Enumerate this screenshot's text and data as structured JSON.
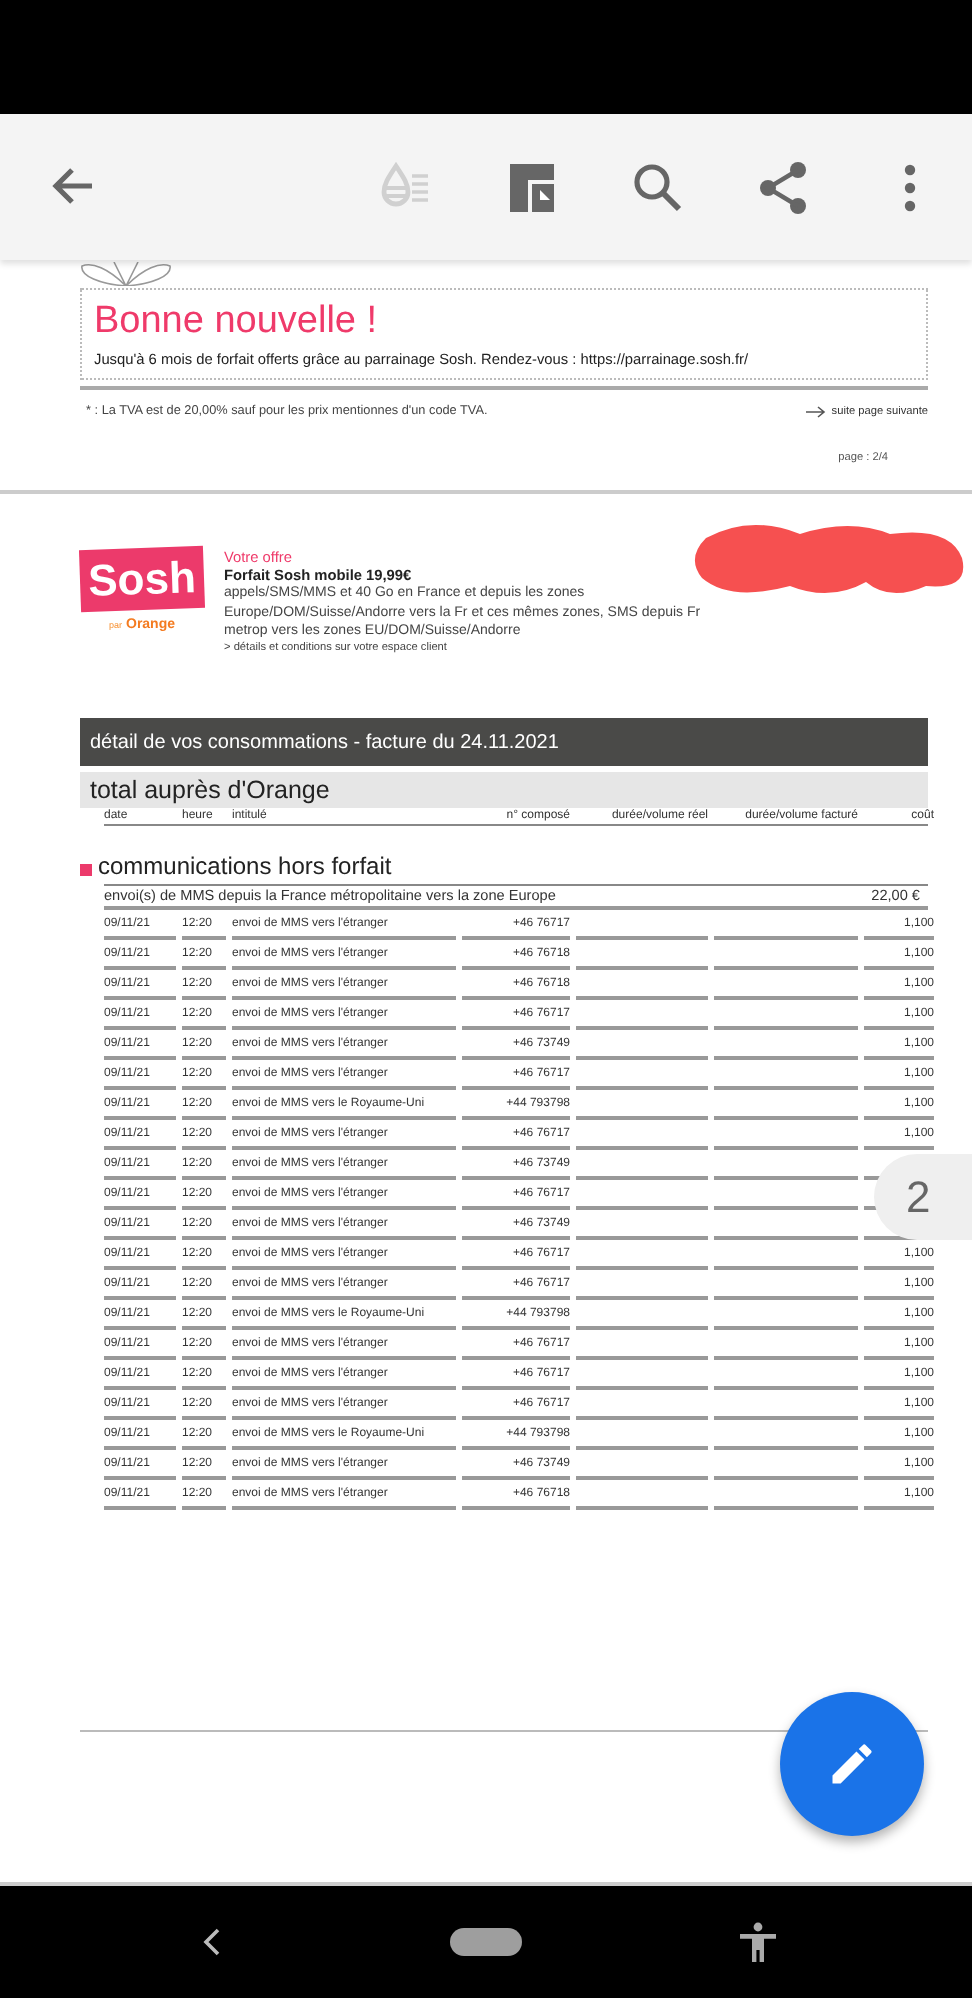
{
  "toolbar": {
    "buttons": [
      {
        "kind": "back",
        "disabled": false
      },
      {
        "kind": "ink",
        "disabled": true
      },
      {
        "kind": "layout",
        "disabled": false
      },
      {
        "kind": "search",
        "disabled": false
      },
      {
        "kind": "share",
        "disabled": false
      },
      {
        "kind": "more",
        "disabled": false
      }
    ]
  },
  "page_2": {
    "promo": {
      "title": "Bonne nouvelle !",
      "text": "Jusqu'à 6 mois de forfait offerts grâce au parrainage Sosh. Rendez-vous : https://parrainage.sosh.fr/"
    },
    "footnote": "* : La TVA est de 20,00% sauf pour les prix mentionnes d'un code TVA.",
    "next_page": "suite page suivante",
    "page_number": "page : 2/4"
  },
  "page_3": {
    "offer": {
      "logo": "Sosh",
      "logo_by": "par",
      "logo_brand": "Orange",
      "label": "Votre offre",
      "plan": "Forfait Sosh mobile 19,99€",
      "description": [
        "appels/SMS/MMS et 40 Go en France et depuis les zones",
        "Europe/DOM/Suisse/Andorre vers la Fr et ces mêmes zones, SMS depuis Fr",
        "metrop vers les zones EU/DOM/Suisse/Andorre"
      ],
      "link": "> détails et conditions sur votre espace client"
    },
    "section_title": "détail de vos consommations - facture du 24.11.2021",
    "total_title": "total auprès d'Orange",
    "columns": [
      "date",
      "heure",
      "intitulé",
      "n° composé",
      "durée/volume réel",
      "durée/volume facturé",
      "coût"
    ],
    "category": "communications hors forfait",
    "group": {
      "label": "envoi(s) de MMS depuis la France métropolitaine vers la zone Europe",
      "amount": "22,00 €"
    },
    "rows": [
      {
        "date": "09/11/21",
        "time": "12:20",
        "label": "envoi de MMS vers l'étranger",
        "number": "+46 76717",
        "cost": "1,100"
      },
      {
        "date": "09/11/21",
        "time": "12:20",
        "label": "envoi de MMS vers l'étranger",
        "number": "+46 76718",
        "cost": "1,100"
      },
      {
        "date": "09/11/21",
        "time": "12:20",
        "label": "envoi de MMS vers l'étranger",
        "number": "+46 76718",
        "cost": "1,100"
      },
      {
        "date": "09/11/21",
        "time": "12:20",
        "label": "envoi de MMS vers l'étranger",
        "number": "+46 76717",
        "cost": "1,100"
      },
      {
        "date": "09/11/21",
        "time": "12:20",
        "label": "envoi de MMS vers l'étranger",
        "number": "+46 73749",
        "cost": "1,100"
      },
      {
        "date": "09/11/21",
        "time": "12:20",
        "label": "envoi de MMS vers l'étranger",
        "number": "+46 76717",
        "cost": "1,100"
      },
      {
        "date": "09/11/21",
        "time": "12:20",
        "label": "envoi de MMS vers le Royaume-Uni",
        "number": "+44 793798",
        "cost": "1,100"
      },
      {
        "date": "09/11/21",
        "time": "12:20",
        "label": "envoi de MMS vers l'étranger",
        "number": "+46 76717",
        "cost": "1,100"
      },
      {
        "date": "09/11/21",
        "time": "12:20",
        "label": "envoi de MMS vers l'étranger",
        "number": "+46 73749"
      },
      {
        "date": "09/11/21",
        "time": "12:20",
        "label": "envoi de MMS vers l'étranger",
        "number": "+46 76717"
      },
      {
        "date": "09/11/21",
        "time": "12:20",
        "label": "envoi de MMS vers l'étranger",
        "number": "+46 73749"
      },
      {
        "date": "09/11/21",
        "time": "12:20",
        "label": "envoi de MMS vers l'étranger",
        "number": "+46 76717",
        "cost": "1,100"
      },
      {
        "date": "09/11/21",
        "time": "12:20",
        "label": "envoi de MMS vers l'étranger",
        "number": "+46 76717",
        "cost": "1,100"
      },
      {
        "date": "09/11/21",
        "time": "12:20",
        "label": "envoi de MMS vers le Royaume-Uni",
        "number": "+44 793798",
        "cost": "1,100"
      },
      {
        "date": "09/11/21",
        "time": "12:20",
        "label": "envoi de MMS vers l'étranger",
        "number": "+46 76717",
        "cost": "1,100"
      },
      {
        "date": "09/11/21",
        "time": "12:20",
        "label": "envoi de MMS vers l'étranger",
        "number": "+46 76717",
        "cost": "1,100"
      },
      {
        "date": "09/11/21",
        "time": "12:20",
        "label": "envoi de MMS vers l'étranger",
        "number": "+46 76717",
        "cost": "1,100"
      },
      {
        "date": "09/11/21",
        "time": "12:20",
        "label": "envoi de MMS vers le Royaume-Uni",
        "number": "+44 793798",
        "cost": "1,100"
      },
      {
        "date": "09/11/21",
        "time": "12:20",
        "label": "envoi de MMS vers l'étranger",
        "number": "+46 73749",
        "cost": "1,100"
      },
      {
        "date": "09/11/21",
        "time": "12:20",
        "label": "envoi de MMS vers l'étranger",
        "number": "+46 76718",
        "cost": "1,100"
      }
    ]
  },
  "page_badge": "2",
  "nav_bar": {
    "buttons": [
      {
        "kind": "back"
      },
      {
        "kind": "home"
      },
      {
        "kind": "accessibility"
      }
    ]
  }
}
